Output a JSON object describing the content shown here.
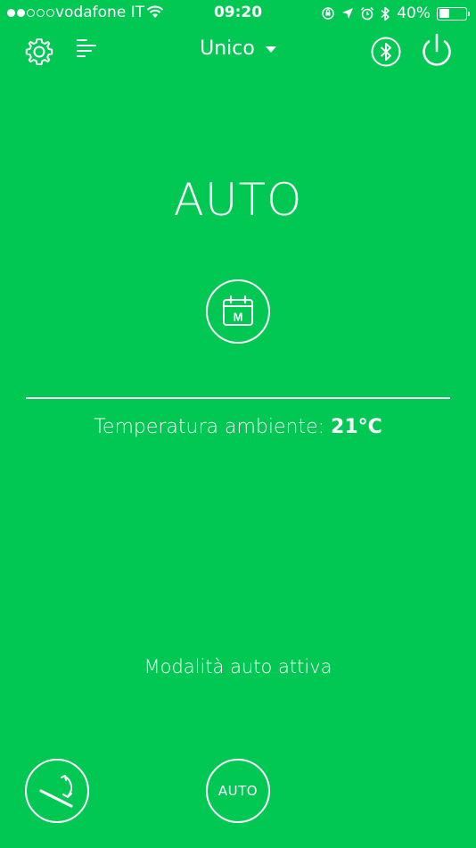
{
  "status_bar": {
    "carrier": "vodafone IT",
    "time": "09:20",
    "battery_percent": "40%",
    "battery_level": 0.4,
    "signal_bars_filled": 2,
    "signal_bars_total": 5
  },
  "toolbar": {
    "zone_label": "Unico",
    "left_icons": [
      "gear-icon",
      "menu-icon"
    ],
    "right_icons": [
      "bluetooth-icon",
      "power-icon"
    ]
  },
  "main": {
    "mode_title": "AUTO",
    "schedule_button_icon": "calendar-m-icon",
    "schedule_letter": "M",
    "temperature_label": "Temperatura ambiente:",
    "temperature_value": "21°C",
    "mode_status": "Modalità auto attiva"
  },
  "bottom": {
    "left_button_icon": "lever-rotate-icon",
    "auto_button_label": "AUTO"
  },
  "colors": {
    "background": "#00c853",
    "foreground": "#ffffff"
  }
}
